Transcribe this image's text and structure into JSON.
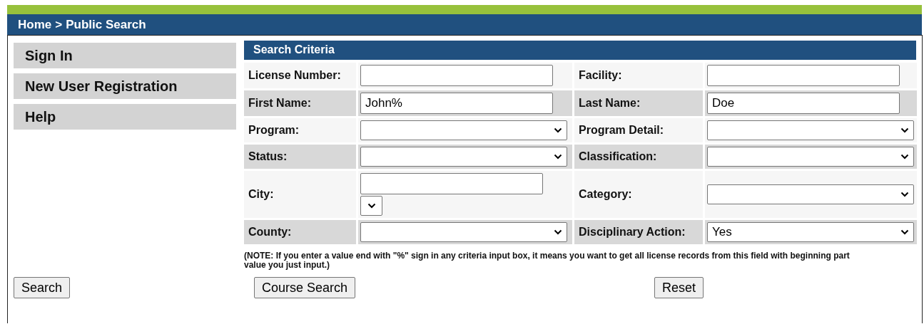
{
  "breadcrumb": {
    "home": "Home",
    "separator": ">",
    "current": "Public Search"
  },
  "sidebar": {
    "items": [
      {
        "label": "Sign In"
      },
      {
        "label": "New User Registration"
      },
      {
        "label": "Help"
      }
    ]
  },
  "criteria": {
    "title": "Search Criteria",
    "rows": [
      {
        "fields": [
          {
            "label": "License Number:",
            "kind": "text"
          },
          {
            "label": "Facility:",
            "kind": "text"
          }
        ]
      },
      {
        "fields": [
          {
            "label": "First Name:",
            "kind": "text",
            "value": "John%"
          },
          {
            "label": "Last Name:",
            "kind": "text",
            "value": "Doe"
          }
        ]
      },
      {
        "fields": [
          {
            "label": "Program:",
            "kind": "select"
          },
          {
            "label": "Program Detail:",
            "kind": "select"
          }
        ]
      },
      {
        "fields": [
          {
            "label": "Status:",
            "kind": "select"
          },
          {
            "label": "Classification:",
            "kind": "select"
          }
        ]
      },
      {
        "fields": [
          {
            "label": "City:",
            "kind": "city"
          },
          {
            "label": "Category:",
            "kind": "select"
          }
        ]
      },
      {
        "fields": [
          {
            "label": "County:",
            "kind": "select"
          },
          {
            "label": "Disciplinary Action:",
            "kind": "select",
            "value": "Yes"
          }
        ]
      }
    ],
    "note": "(NOTE: If you enter a value end with \"%\" sign in any criteria input box, it means you want to get all license records from this field with beginning part value you just input.)"
  },
  "buttons": [
    {
      "label": "Search"
    },
    {
      "label": "Course Search"
    },
    {
      "label": "Reset"
    }
  ]
}
